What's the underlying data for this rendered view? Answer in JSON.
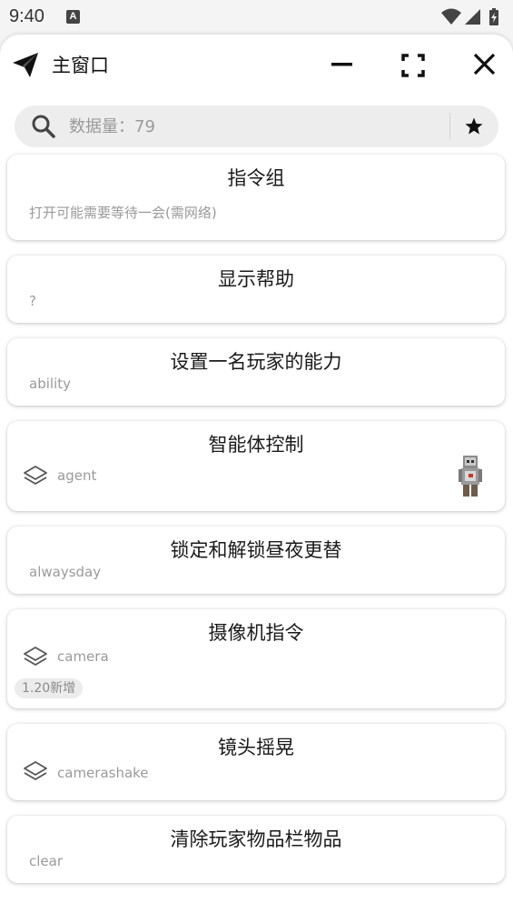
{
  "status": {
    "time": "9:40",
    "notification_letter": "A"
  },
  "window": {
    "title": "主窗口",
    "icon": "paper-plane-icon",
    "controls": [
      "minimize-icon",
      "fullscreen-icon",
      "close-icon"
    ]
  },
  "search": {
    "placeholder": "数据量：79",
    "value": "",
    "favorites_icon": "star-icon"
  },
  "commands": [
    {
      "title": "指令组",
      "subtitle": "打开可能需要等待一会(需网络)",
      "layers_icon": false,
      "badge": ""
    },
    {
      "title": "显示帮助",
      "subtitle": "?",
      "layers_icon": false,
      "badge": ""
    },
    {
      "title": "设置一名玩家的能力",
      "subtitle": "ability",
      "layers_icon": false,
      "badge": ""
    },
    {
      "title": "智能体控制",
      "subtitle": "agent",
      "layers_icon": true,
      "badge": "",
      "thumbnail": "agent-figure-icon"
    },
    {
      "title": "锁定和解锁昼夜更替",
      "subtitle": "alwaysday",
      "layers_icon": false,
      "badge": ""
    },
    {
      "title": "摄像机指令",
      "subtitle": "camera",
      "layers_icon": true,
      "badge": "1.20新增"
    },
    {
      "title": "镜头摇晃",
      "subtitle": "camerashake",
      "layers_icon": true,
      "badge": ""
    },
    {
      "title": "清除玩家物品栏物品",
      "subtitle": "clear",
      "layers_icon": false,
      "badge": ""
    }
  ],
  "colors": {
    "background": "#f4f4f4",
    "card": "#ffffff",
    "subtitle": "#9a9a9a",
    "title": "#1a1a1a"
  }
}
